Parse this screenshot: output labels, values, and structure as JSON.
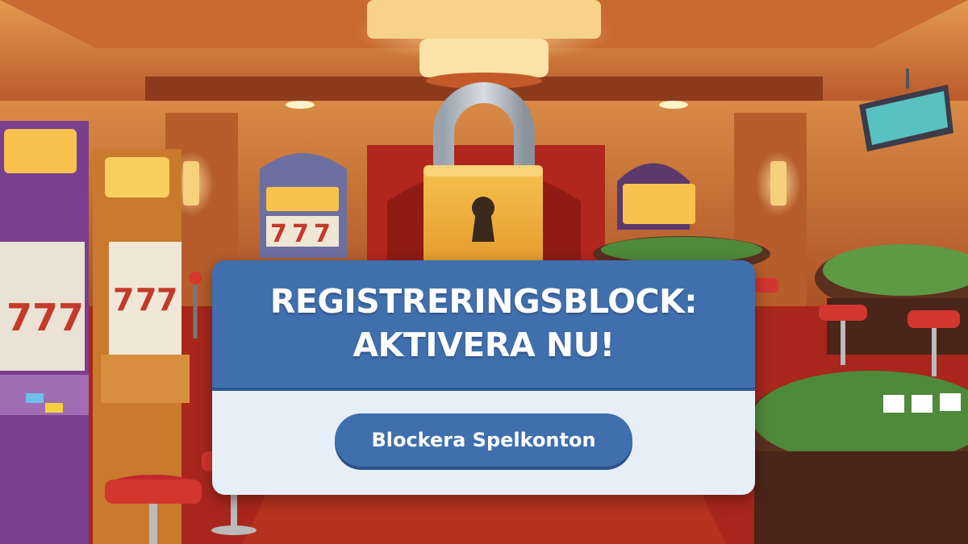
{
  "dialog": {
    "title_line1": "REGISTRERINGSBLOCK:",
    "title_line2": "AKTIVERA NU!",
    "button_label": "Blockera Spelkonton"
  },
  "scene": {
    "slot_reel_symbol": "7",
    "icons": [
      "padlock-icon",
      "keyhole-icon",
      "slot-machine",
      "card-table",
      "bar-stool",
      "tv-screen",
      "marquee-sign",
      "wall-sconce"
    ]
  },
  "colors": {
    "header_blue": "#3f6fad",
    "body_light": "#e6eef7",
    "padlock_gold": "#f2b33d",
    "felt_green": "#4f8a3a",
    "carpet_red": "#a8261c"
  }
}
